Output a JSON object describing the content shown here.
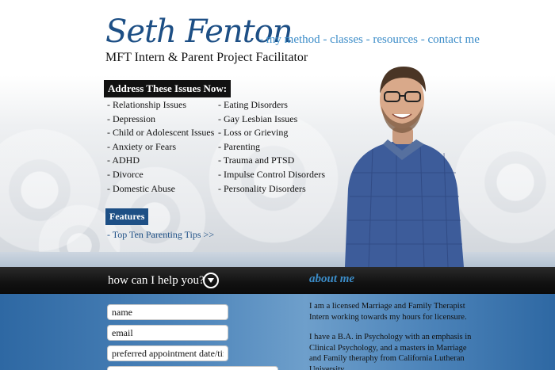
{
  "header": {
    "logo_text": "Seth Fenton",
    "subtitle": "MFT Intern & Parent Project Facilitator",
    "nav": [
      {
        "label": "my method"
      },
      {
        "label": "classes"
      },
      {
        "label": "resources"
      },
      {
        "label": "contact me"
      }
    ],
    "nav_separator": " - "
  },
  "issues": {
    "heading": "Address These Issues Now:",
    "col1": [
      "- Relationship Issues",
      "- Depression",
      "- Child or Adolescent Issues",
      "- Anxiety or Fears",
      "- ADHD",
      "- Divorce",
      "- Domestic Abuse"
    ],
    "col2": [
      "- Eating Disorders",
      "- Gay Lesbian Issues",
      "- Loss or Grieving",
      "- Parenting",
      "- Trauma and PTSD",
      "- Impulse Control Disorders",
      "- Personality Disorders"
    ]
  },
  "features": {
    "heading": "Features",
    "link": "- Top Ten Parenting Tips >>"
  },
  "band": {
    "help_label": "how can I help you?",
    "about_label": "about me"
  },
  "form": {
    "name_placeholder": "name",
    "email_placeholder": "email",
    "date_placeholder": "preferred appointment date/time",
    "extra_placeholder": ""
  },
  "about": {
    "para1": "I am a licensed Marriage and Family Therapist Intern working towards my hours for licensure.",
    "para2": "I have a B.A. in Psychology with an emphasis in Clinical Psychology, and a masters in Marriage and Family theraphy from California Lutheran University."
  },
  "colors": {
    "brand": "#1d4f85",
    "link": "#3b8cc8",
    "band": "#111111",
    "lower_blue": "#4f86bb"
  }
}
